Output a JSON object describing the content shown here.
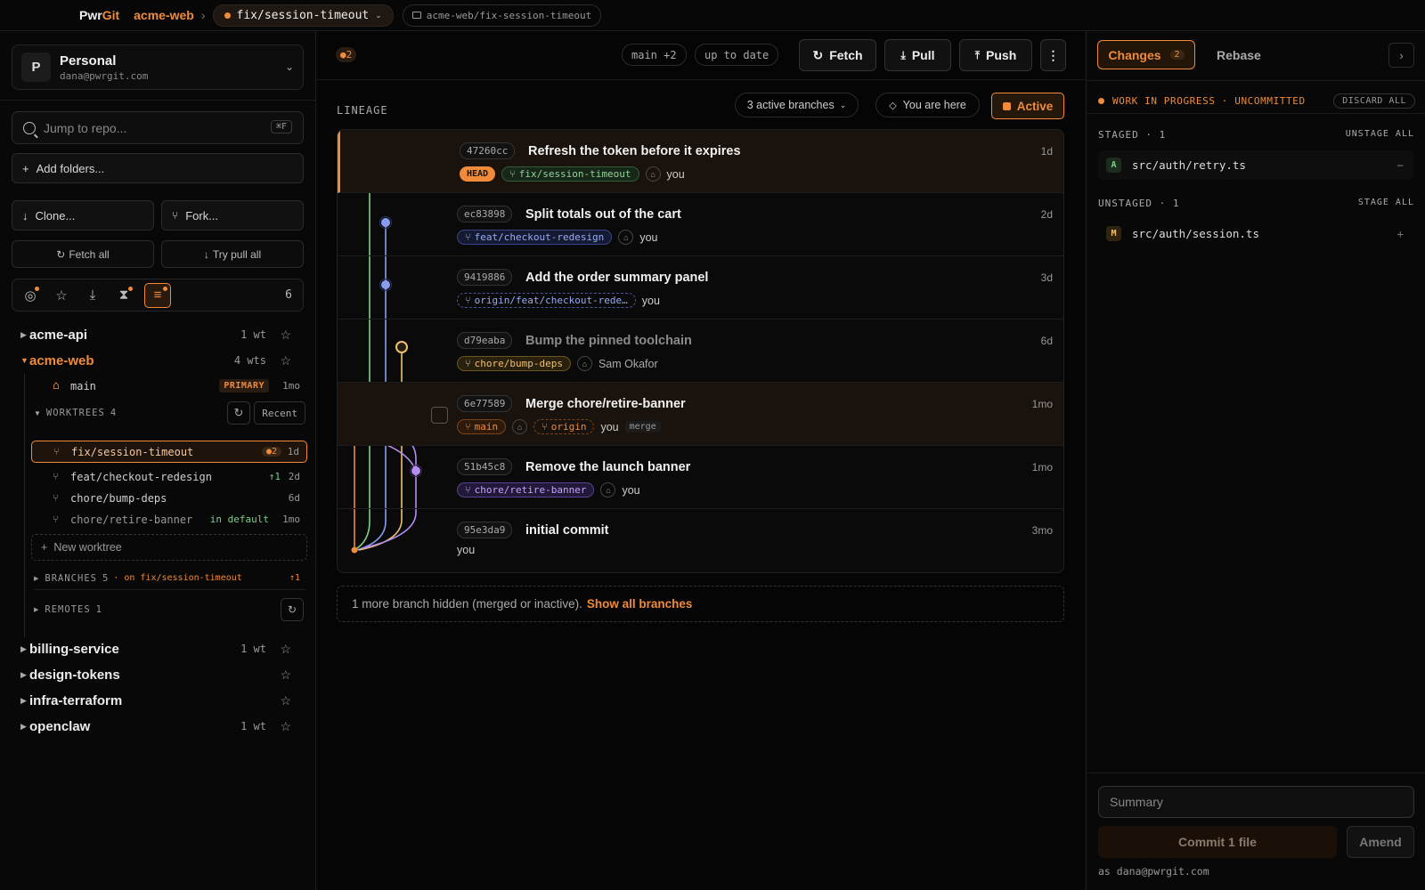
{
  "topbar": {
    "brand_a": "Pwr",
    "brand_b": "Git",
    "repo": "acme-web",
    "branch": "fix/session-timeout",
    "path": "acme-web/fix-session-timeout"
  },
  "sidebar": {
    "account": {
      "initial": "P",
      "name": "Personal",
      "email": "dana@pwrgit.com"
    },
    "search": {
      "placeholder": "Jump to repo...",
      "shortcut": "⌘F"
    },
    "add_folders": "Add folders...",
    "clone": "Clone...",
    "fork": "Fork...",
    "fetch_all": "Fetch all",
    "try_pull_all": "Try pull all",
    "filter_count": "6",
    "repos_top": [
      {
        "name": "acme-api",
        "wt": "1 wt"
      },
      {
        "name": "acme-web",
        "wt": "4 wts"
      }
    ],
    "main_branch": {
      "name": "main",
      "badge": "PRIMARY",
      "age": "1mo"
    },
    "worktrees_header": "WORKTREES",
    "worktrees_count": "4",
    "recent": "Recent",
    "worktrees": [
      {
        "name": "fix/session-timeout",
        "changes": "●2",
        "age": "1d"
      },
      {
        "name": "feat/checkout-redesign",
        "ahead": "↑1",
        "age": "2d"
      },
      {
        "name": "chore/bump-deps",
        "age": "6d"
      },
      {
        "name": "chore/retire-banner",
        "status": "in default",
        "age": "1mo"
      }
    ],
    "new_worktree": "New worktree",
    "branches": {
      "label": "BRANCHES",
      "count": "5",
      "on": "· on fix/session-timeout",
      "ahead": "↑1"
    },
    "remotes": {
      "label": "REMOTES",
      "count": "1"
    },
    "repos_bottom": [
      {
        "name": "billing-service",
        "wt": "1 wt"
      },
      {
        "name": "design-tokens",
        "wt": ""
      },
      {
        "name": "infra-terraform",
        "wt": ""
      },
      {
        "name": "openclaw",
        "wt": "1 wt"
      }
    ]
  },
  "main": {
    "changes_badge": "●2",
    "base_pill": "main +2",
    "sync_pill": "up to date",
    "fetch": "Fetch",
    "pull": "Pull",
    "push": "Push",
    "lineage": "LINEAGE",
    "active_branches": "3 active branches",
    "you_are_here": "You are here",
    "active": "Active",
    "commits": [
      {
        "sha": "47260cc",
        "msg": "Refresh the token before it expires",
        "age": "1d",
        "head": "HEAD",
        "branch": "fix/session-timeout",
        "author": "you"
      },
      {
        "sha": "ec83898",
        "msg": "Split totals out of the cart",
        "age": "2d",
        "branch": "feat/checkout-redesign",
        "author": "you"
      },
      {
        "sha": "9419886",
        "msg": "Add the order summary panel",
        "age": "3d",
        "branch": "origin/feat/checkout-rede…",
        "author": "you"
      },
      {
        "sha": "d79eaba",
        "msg": "Bump the pinned toolchain",
        "age": "6d",
        "branch": "chore/bump-deps",
        "author": "Sam Okafor"
      },
      {
        "sha": "6e77589",
        "msg": "Merge chore/retire-banner",
        "age": "1mo",
        "branch": "main",
        "branch2": "origin",
        "author": "you",
        "kind": "merge"
      },
      {
        "sha": "51b45c8",
        "msg": "Remove the launch banner",
        "age": "1mo",
        "branch": "chore/retire-banner",
        "author": "you"
      },
      {
        "sha": "95e3da9",
        "msg": "initial commit",
        "age": "3mo",
        "author": "you"
      }
    ],
    "hidden_note": "1 more branch hidden (merged or inactive).",
    "show_all": "Show all branches"
  },
  "right": {
    "tab_changes": "Changes",
    "tab_changes_count": "2",
    "tab_rebase": "Rebase",
    "wip": "WORK IN PROGRESS · UNCOMMITTED",
    "discard_all": "DISCARD ALL",
    "staged": "STAGED · 1",
    "unstage_all": "UNSTAGE ALL",
    "staged_files": [
      {
        "status": "A",
        "path": "src/auth/retry.ts"
      }
    ],
    "unstaged": "UNSTAGED · 1",
    "stage_all": "STAGE ALL",
    "unstaged_files": [
      {
        "status": "M",
        "path": "src/auth/session.ts"
      }
    ],
    "summary_placeholder": "Summary",
    "commit": "Commit 1 file",
    "amend": "Amend",
    "as_user": "as dana@pwrgit.com"
  },
  "colors": {
    "accent": "#ef8b3a",
    "green": "#7fcf8a",
    "blue": "#8a9cf0",
    "yellow": "#f0c070",
    "purple": "#b48ef0"
  }
}
